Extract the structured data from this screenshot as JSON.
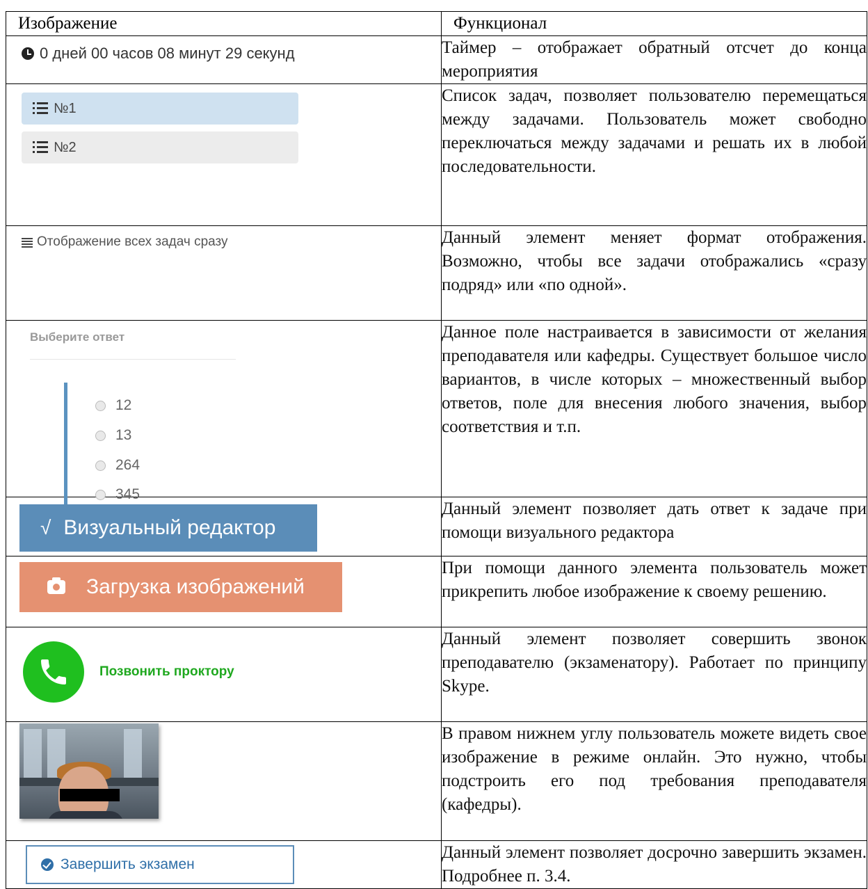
{
  "headers": {
    "image": "Изображение",
    "function": "Функционал"
  },
  "rows": [
    {
      "timer_text": "0 дней 00 часов 08 минут 29 секунд",
      "description": "Таймер – отображает обратный отсчет до конца мероприятия"
    },
    {
      "tasks": [
        "№1",
        "№2"
      ],
      "description": "Список задач, позволяет пользователю перемещаться между задачами. Пользователь может свободно переключаться между задачами и решать их в любой последовательности."
    },
    {
      "toggle_label": "Отображение всех задач сразу",
      "description": "Данный элемент меняет формат отображения. Возможно, чтобы все задачи отображались «сразу подряд» или «по одной»."
    },
    {
      "choose_title": "Выберите ответ",
      "options": [
        "12",
        "13",
        "264",
        "345"
      ],
      "description": "Данное поле настраивается в зависимости от желания преподавателя или кафедры. Существует большое число вариантов, в числе которых – множественный выбор ответов, поле для внесения любого значения, выбор соответствия и т.п."
    },
    {
      "button_symbol": "√",
      "button_label": "Визуальный редактор",
      "description": "Данный элемент позволяет дать ответ к задаче при помощи визуального редактора"
    },
    {
      "button_label": "Загрузка изображений",
      "description": "При помощи данного элемента пользователь может прикрепить любое изображение к своему решению."
    },
    {
      "call_label": "Позвонить проктору",
      "description": "Данный элемент позволяет совершить звонок преподавателю (экзаменатору). Работает по принципу Skype."
    },
    {
      "description": "В правом нижнем углу пользователь можете видеть свое изображение в режиме онлайн. Это нужно, чтобы подстроить его под требования преподавателя (кафедры)."
    },
    {
      "button_label": "Завершить экзамен",
      "description": "Данный элемент позволяет досрочно завершить экзамен. Подробнее п. 3.4."
    }
  ],
  "colors": {
    "visual_editor": "#5b8db8",
    "upload": "#e59171",
    "call": "#1fbf1f",
    "finish_border": "#5b8db8",
    "task_active": "#cfe1f0",
    "task_inactive": "#ececec"
  }
}
